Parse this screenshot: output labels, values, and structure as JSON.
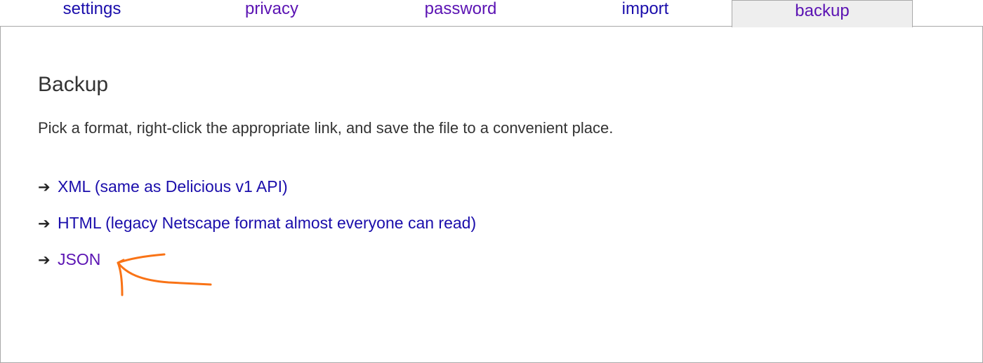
{
  "tabs": [
    {
      "label": "settings",
      "visited": false
    },
    {
      "label": "privacy",
      "visited": true
    },
    {
      "label": "password",
      "visited": true
    },
    {
      "label": "import",
      "visited": false
    },
    {
      "label": "backup",
      "visited": true,
      "active": true
    }
  ],
  "panel": {
    "heading": "Backup",
    "instructions": "Pick a format, right-click the appropriate link, and save the file to a convenient place.",
    "formats": [
      {
        "arrow": "➔",
        "label": "XML (same as Delicious v1 API)",
        "visited": false
      },
      {
        "arrow": "➔",
        "label": "HTML (legacy Netscape format almost everyone can read)",
        "visited": false
      },
      {
        "arrow": "➔",
        "label": "JSON",
        "visited": true
      }
    ]
  },
  "annotation": {
    "color": "#f97316",
    "points_to": "JSON"
  },
  "colors": {
    "link_unvisited": "#1a0dab",
    "link_visited": "#5b13b3",
    "active_tab_bg": "#eeeeee",
    "border": "#a9a9a9"
  }
}
